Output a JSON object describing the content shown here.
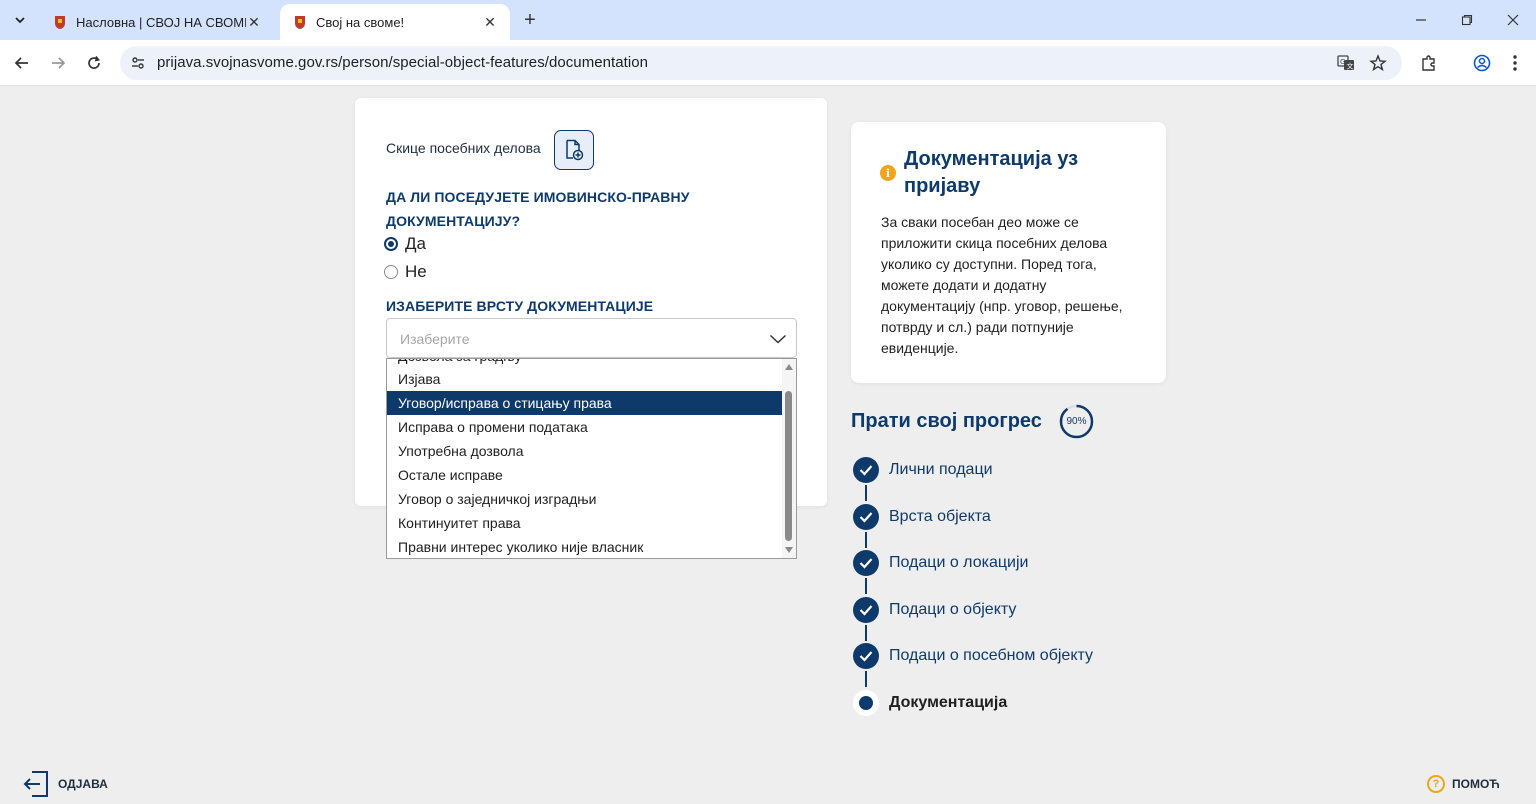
{
  "browser": {
    "tabs": [
      {
        "title": "Насловна | СВОЈ НА СВОМЕ",
        "active": false
      },
      {
        "title": "Свој на своме!",
        "active": true
      }
    ],
    "url": "prijava.svojnasvome.gov.rs/person/special-object-features/documentation"
  },
  "form": {
    "sketch_label": "Скице посебних делова",
    "question": "ДА ЛИ ПОСЕДУЈЕТЕ ИМОВИНСКО-ПРАВНУ ДОКУМЕНТАЦИЈУ?",
    "radio_yes": "Да",
    "radio_no": "Не",
    "selected_radio": "yes",
    "type_label": "ИЗАБЕРИТЕ ВРСТУ ДОКУМЕНТАЦИЈЕ",
    "select_placeholder": "Изаберите",
    "options": [
      "Дозвола за градњу",
      "Изјава",
      "Уговор/исправа о стицању права",
      "Исправа о промени података",
      "Употребна дозвола",
      "Остале исправе",
      "Уговор о заједничкој изградњи",
      "Континуитет права",
      "Правни интерес уколико није власник"
    ],
    "highlighted_option": "Уговор/исправа о стицању права"
  },
  "info": {
    "title": "Документација уз пријаву",
    "text": "За сваки посебан део може се приложити скица посебних делова уколико су доступни. Поред тога, можете додати и додатну документацију (нпр. уговор, решење, потврду и сл.) ради потпуније евиденције."
  },
  "progress": {
    "title": "Прати свој прогрес",
    "percent_label": "90%",
    "percent": 90,
    "steps": [
      {
        "label": "Лични подаци",
        "status": "done"
      },
      {
        "label": "Врста објекта",
        "status": "done"
      },
      {
        "label": "Подаци о локацији",
        "status": "done"
      },
      {
        "label": "Подаци о објекту",
        "status": "done"
      },
      {
        "label": "Подаци о посебном објекту",
        "status": "done"
      },
      {
        "label": "Документација",
        "status": "current"
      }
    ]
  },
  "footer": {
    "logout": "ОДЈАВА",
    "help": "ПОМОЋ"
  },
  "colors": {
    "primary": "#0e3a6b",
    "accent": "#f0a41c",
    "page_bg": "#eeeeee"
  }
}
